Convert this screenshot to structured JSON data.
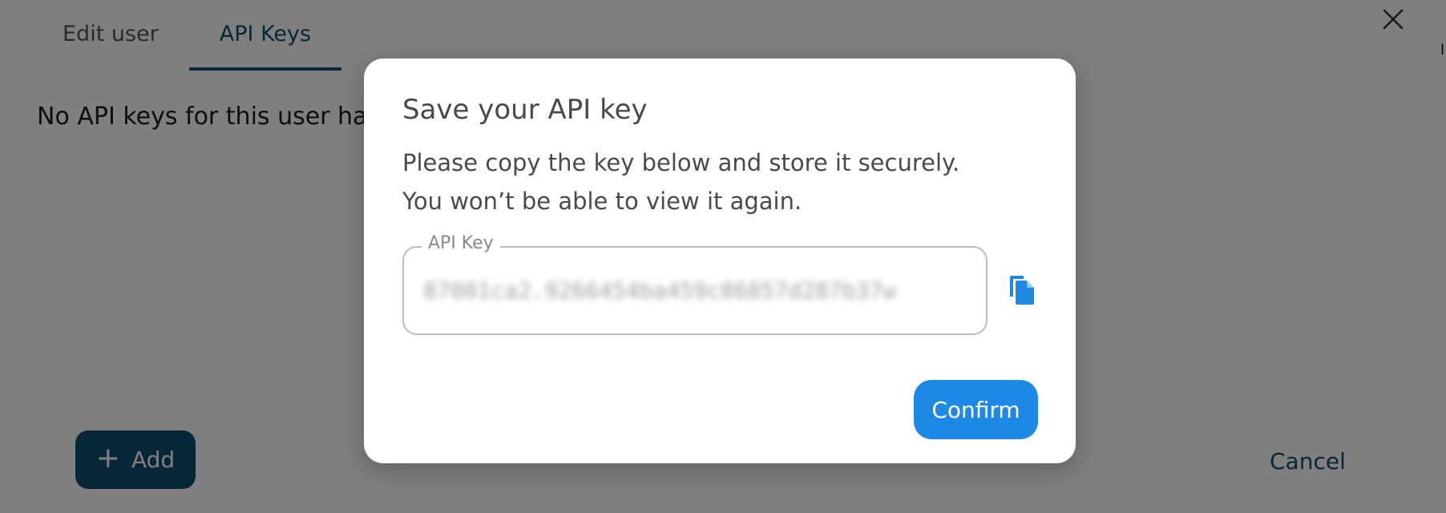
{
  "tabs": [
    {
      "label": "Edit user",
      "active": false
    },
    {
      "label": "API Keys",
      "active": true
    }
  ],
  "empty_message": "No API keys for this user ha",
  "add_button": {
    "label": "Add",
    "icon": "plus-icon"
  },
  "cancel_button": {
    "label": "Cancel"
  },
  "close_icon": "close-icon",
  "edge_mark": "l",
  "modal": {
    "title": "Save your API key",
    "description_line1": "Please copy the key below and store it securely.",
    "description_line2": "You won’t be able to view it again.",
    "field_label": "API Key",
    "field_value": "87001ca2.9266454ba459c86857d287b37w",
    "copy_icon": "copy-icon",
    "confirm_label": "Confirm"
  },
  "colors": {
    "primary_dark": "#0f4c6e",
    "primary_blue": "#1e88e5",
    "overlay": "rgba(0,0,0,0.5)"
  }
}
